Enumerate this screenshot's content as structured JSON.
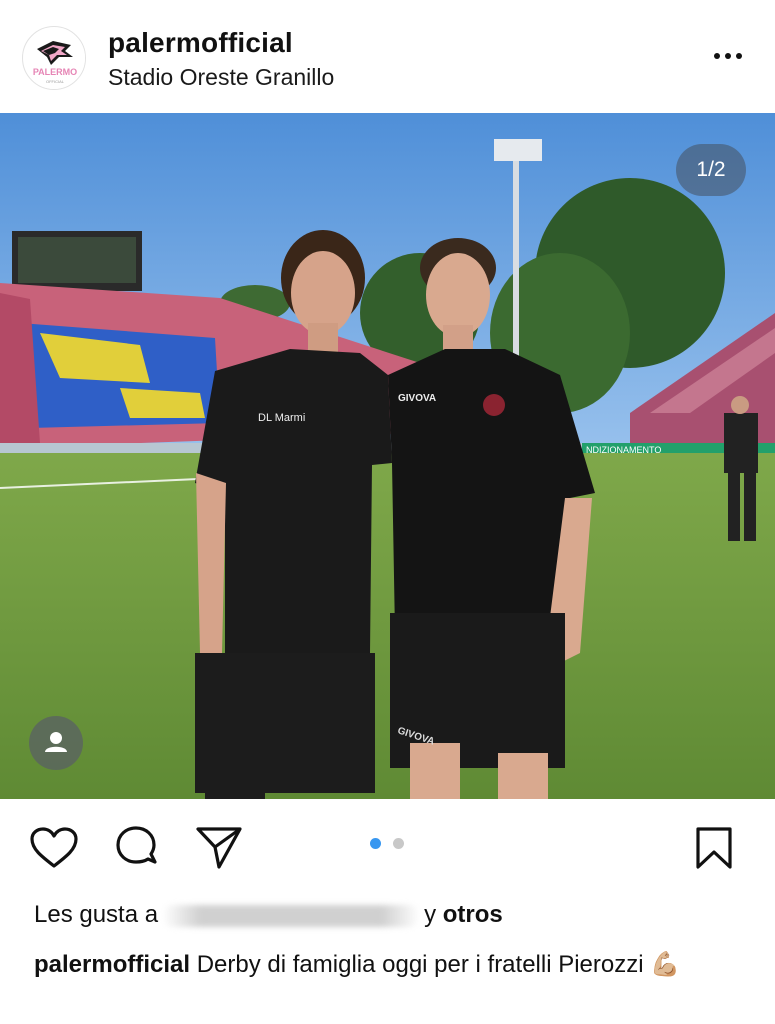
{
  "post": {
    "username": "palermofficial",
    "location": "Stadio Oreste Granillo",
    "avatar_text": "PALERMO",
    "more_icon": "more-horizontal-icon",
    "image_counter": "1/2",
    "carousel": {
      "current": 1,
      "total": 2
    }
  },
  "photo": {
    "left_shirt_sponsor": "DL Marmi",
    "right_shirt_brand": "GIVOVA",
    "right_shorts_brand": "GIVOVA",
    "stadium_banner": "NDIZIONAMENTO"
  },
  "actions": {
    "like_icon": "heart-icon",
    "comment_icon": "comment-bubble-icon",
    "share_icon": "paper-plane-icon",
    "save_icon": "bookmark-icon"
  },
  "likes": {
    "prefix": "Les gusta a",
    "connector": "y",
    "others": "otros"
  },
  "caption": {
    "username": "palermofficial",
    "text": "Derby di famiglia oggi per i fratelli Pierozzi",
    "emoji": "💪🏼"
  },
  "colors": {
    "accent_blue": "#3897f0",
    "inactive_dot": "#c8c8c8",
    "text": "#111111"
  }
}
